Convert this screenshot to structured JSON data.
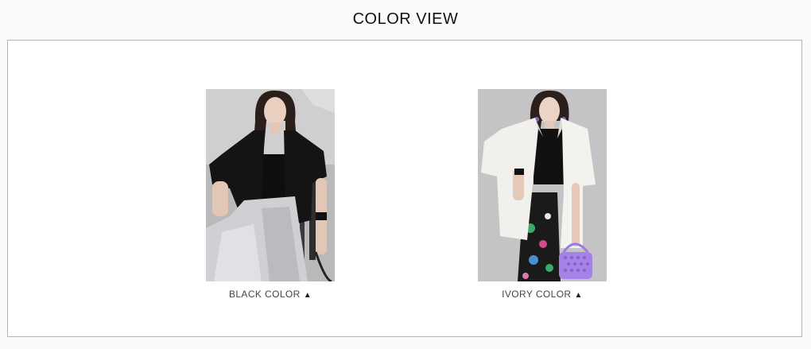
{
  "section": {
    "title": "COLOR VIEW"
  },
  "swatches": [
    {
      "label": "BLACK COLOR",
      "arrow": "▲",
      "jacket_color": "#141414"
    },
    {
      "label": "IVORY COLOR",
      "arrow": "▲",
      "jacket_color": "#f1f0ec"
    }
  ],
  "icons": {
    "caption_arrow": "triangle-up-icon"
  }
}
